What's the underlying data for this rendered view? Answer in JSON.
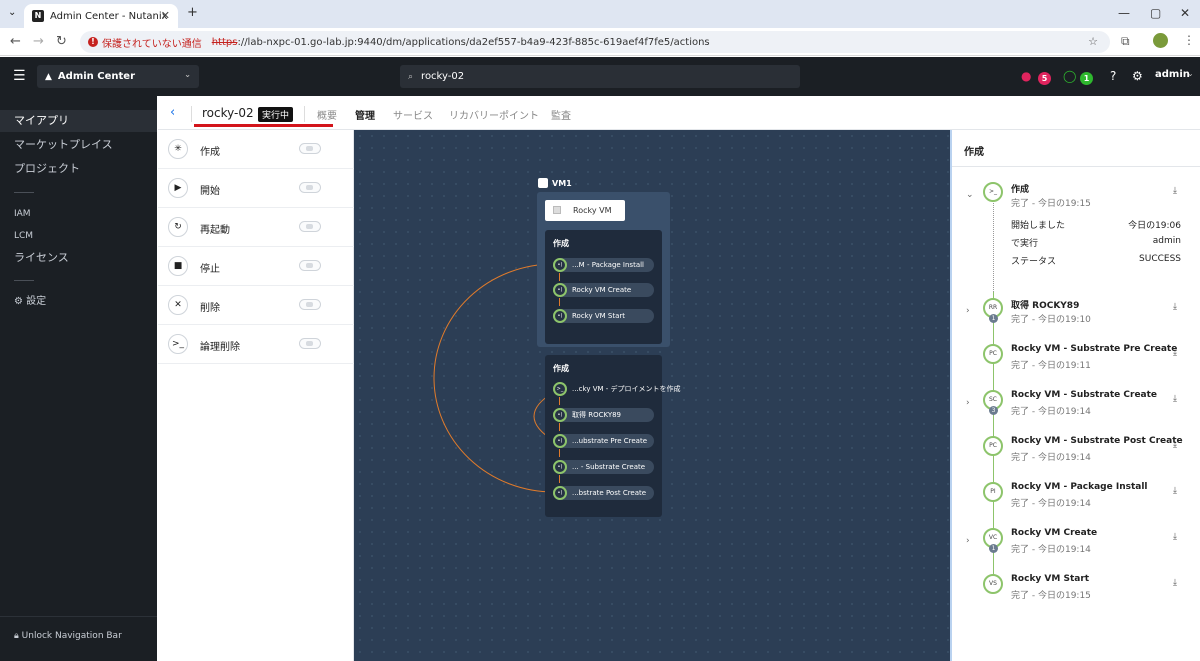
{
  "browser": {
    "tab_title": "Admin Center - Nutanix",
    "security_label": "保護されていない通信",
    "url_scheme": "https",
    "url_rest": "://lab-nxpc-01.go-lab.jp:9440/dm/applications/da2ef557-b4a9-423f-885c-619aef4f7fe5/actions"
  },
  "header": {
    "app_selector": "Admin Center",
    "search_value": "rocky-02",
    "alerts_count": "5",
    "tasks_count": "1",
    "user": "admin"
  },
  "sidebar": {
    "items": [
      {
        "label": "マイアプリ"
      },
      {
        "label": "マーケットプレイス"
      },
      {
        "label": "プロジェクト"
      },
      {
        "label": "IAM"
      },
      {
        "label": "LCM"
      },
      {
        "label": "ライセンス"
      },
      {
        "label": "設定"
      }
    ],
    "unlock": "Unlock Navigation Bar"
  },
  "app": {
    "name": "rocky-02",
    "state": "実行中",
    "tabs": [
      "概要",
      "管理",
      "サービス",
      "リカバリーポイント",
      "監査"
    ]
  },
  "actions": [
    {
      "label": "作成",
      "icon": "sparkle-icon"
    },
    {
      "label": "開始",
      "icon": "play-icon"
    },
    {
      "label": "再起動",
      "icon": "restart-icon"
    },
    {
      "label": "停止",
      "icon": "stop-icon"
    },
    {
      "label": "削除",
      "icon": "delete-icon"
    },
    {
      "label": "論理削除",
      "icon": "terminal-icon"
    }
  ],
  "canvas": {
    "vm_label": "VM1",
    "vm_name": "Rocky VM",
    "panel1_title": "作成",
    "panel1_tasks": [
      "...M - Package Install",
      "Rocky VM Create",
      "Rocky VM Start"
    ],
    "panel2_title": "作成",
    "panel2_tasks": [
      "...cky VM - デプロイメントを作成",
      "取得 ROCKY89",
      "...ubstrate Pre Create",
      "... - Substrate Create",
      "...bstrate Post Create"
    ]
  },
  "right_panel": {
    "title": "作成",
    "details": {
      "started_label": "開始しました",
      "started_value": "今日の19:06",
      "run_by_label": "で実行",
      "run_by_value": "admin",
      "status_label": "ステータス",
      "status_value": "SUCCESS"
    },
    "steps": [
      {
        "title": "作成",
        "status": "完了 - 今日の19:15",
        "icon": ">_"
      },
      {
        "title": "取得 ROCKY89",
        "status": "完了 - 今日の19:10",
        "icon": "RR",
        "sub": "1"
      },
      {
        "title": "Rocky VM - Substrate Pre Create",
        "status": "完了 - 今日の19:11",
        "icon": "PC"
      },
      {
        "title": "Rocky VM - Substrate Create",
        "status": "完了 - 今日の19:14",
        "icon": "SC",
        "sub": "3"
      },
      {
        "title": "Rocky VM - Substrate Post Create",
        "status": "完了 - 今日の19:14",
        "icon": "PC"
      },
      {
        "title": "Rocky VM - Package Install",
        "status": "完了 - 今日の19:14",
        "icon": "PI"
      },
      {
        "title": "Rocky VM Create",
        "status": "完了 - 今日の19:14",
        "icon": "VC",
        "sub": "1"
      },
      {
        "title": "Rocky VM Start",
        "status": "完了 - 今日の19:15",
        "icon": "VS"
      }
    ]
  }
}
